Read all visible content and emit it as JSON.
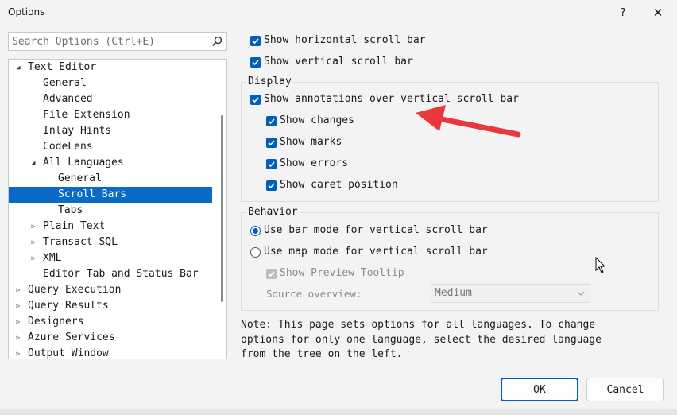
{
  "window": {
    "title": "Options",
    "help_glyph": "?",
    "close_glyph": "✕"
  },
  "search": {
    "placeholder": "Search Options (Ctrl+E)"
  },
  "tree": {
    "items": [
      {
        "label": "Text Editor",
        "level": 1,
        "state": "expanded"
      },
      {
        "label": "General",
        "level": 2,
        "state": "leaf"
      },
      {
        "label": "Advanced",
        "level": 2,
        "state": "leaf"
      },
      {
        "label": "File Extension",
        "level": 2,
        "state": "leaf"
      },
      {
        "label": "Inlay Hints",
        "level": 2,
        "state": "leaf"
      },
      {
        "label": "CodeLens",
        "level": 2,
        "state": "leaf"
      },
      {
        "label": "All Languages",
        "level": 2,
        "state": "expanded"
      },
      {
        "label": "General",
        "level": 3,
        "state": "leaf"
      },
      {
        "label": "Scroll Bars",
        "level": 3,
        "state": "leaf",
        "selected": true
      },
      {
        "label": "Tabs",
        "level": 3,
        "state": "leaf"
      },
      {
        "label": "Plain Text",
        "level": 2,
        "state": "collapsed"
      },
      {
        "label": "Transact-SQL",
        "level": 2,
        "state": "collapsed"
      },
      {
        "label": "XML",
        "level": 2,
        "state": "collapsed"
      },
      {
        "label": "Editor Tab and Status Bar",
        "level": 2,
        "state": "leaf"
      },
      {
        "label": "Query Execution",
        "level": 1,
        "state": "collapsed"
      },
      {
        "label": "Query Results",
        "level": 1,
        "state": "collapsed"
      },
      {
        "label": "Designers",
        "level": 1,
        "state": "collapsed"
      },
      {
        "label": "Azure Services",
        "level": 1,
        "state": "collapsed"
      },
      {
        "label": "Output Window",
        "level": 1,
        "state": "collapsed"
      }
    ]
  },
  "options": {
    "show_horizontal": {
      "label": "Show horizontal scroll bar",
      "checked": true
    },
    "show_vertical": {
      "label": "Show vertical scroll bar",
      "checked": true
    }
  },
  "display": {
    "title": "Display",
    "show_annotations": {
      "label": "Show annotations over vertical scroll bar",
      "checked": true
    },
    "show_changes": {
      "label": "Show changes",
      "checked": true
    },
    "show_marks": {
      "label": "Show marks",
      "checked": true
    },
    "show_errors": {
      "label": "Show errors",
      "checked": true
    },
    "show_caret": {
      "label": "Show caret position",
      "checked": true
    }
  },
  "behavior": {
    "title": "Behavior",
    "bar_mode": {
      "label": "Use bar mode for vertical scroll bar",
      "selected": true
    },
    "map_mode": {
      "label": "Use map mode for vertical scroll bar",
      "selected": false
    },
    "preview_tooltip": {
      "label": "Show Preview Tooltip",
      "checked": true,
      "enabled": false
    },
    "source_overview": {
      "label": "Source overview:",
      "value": "Medium"
    }
  },
  "note": {
    "line1": "Note: This page sets options for all languages. To change",
    "line2": "options for only one language, select the desired language",
    "line3": "from the tree on the left."
  },
  "buttons": {
    "ok": "OK",
    "cancel": "Cancel"
  },
  "colors": {
    "accent": "#005fb8",
    "selection": "#0a6ac8",
    "annotation_arrow": "#e8383d"
  }
}
